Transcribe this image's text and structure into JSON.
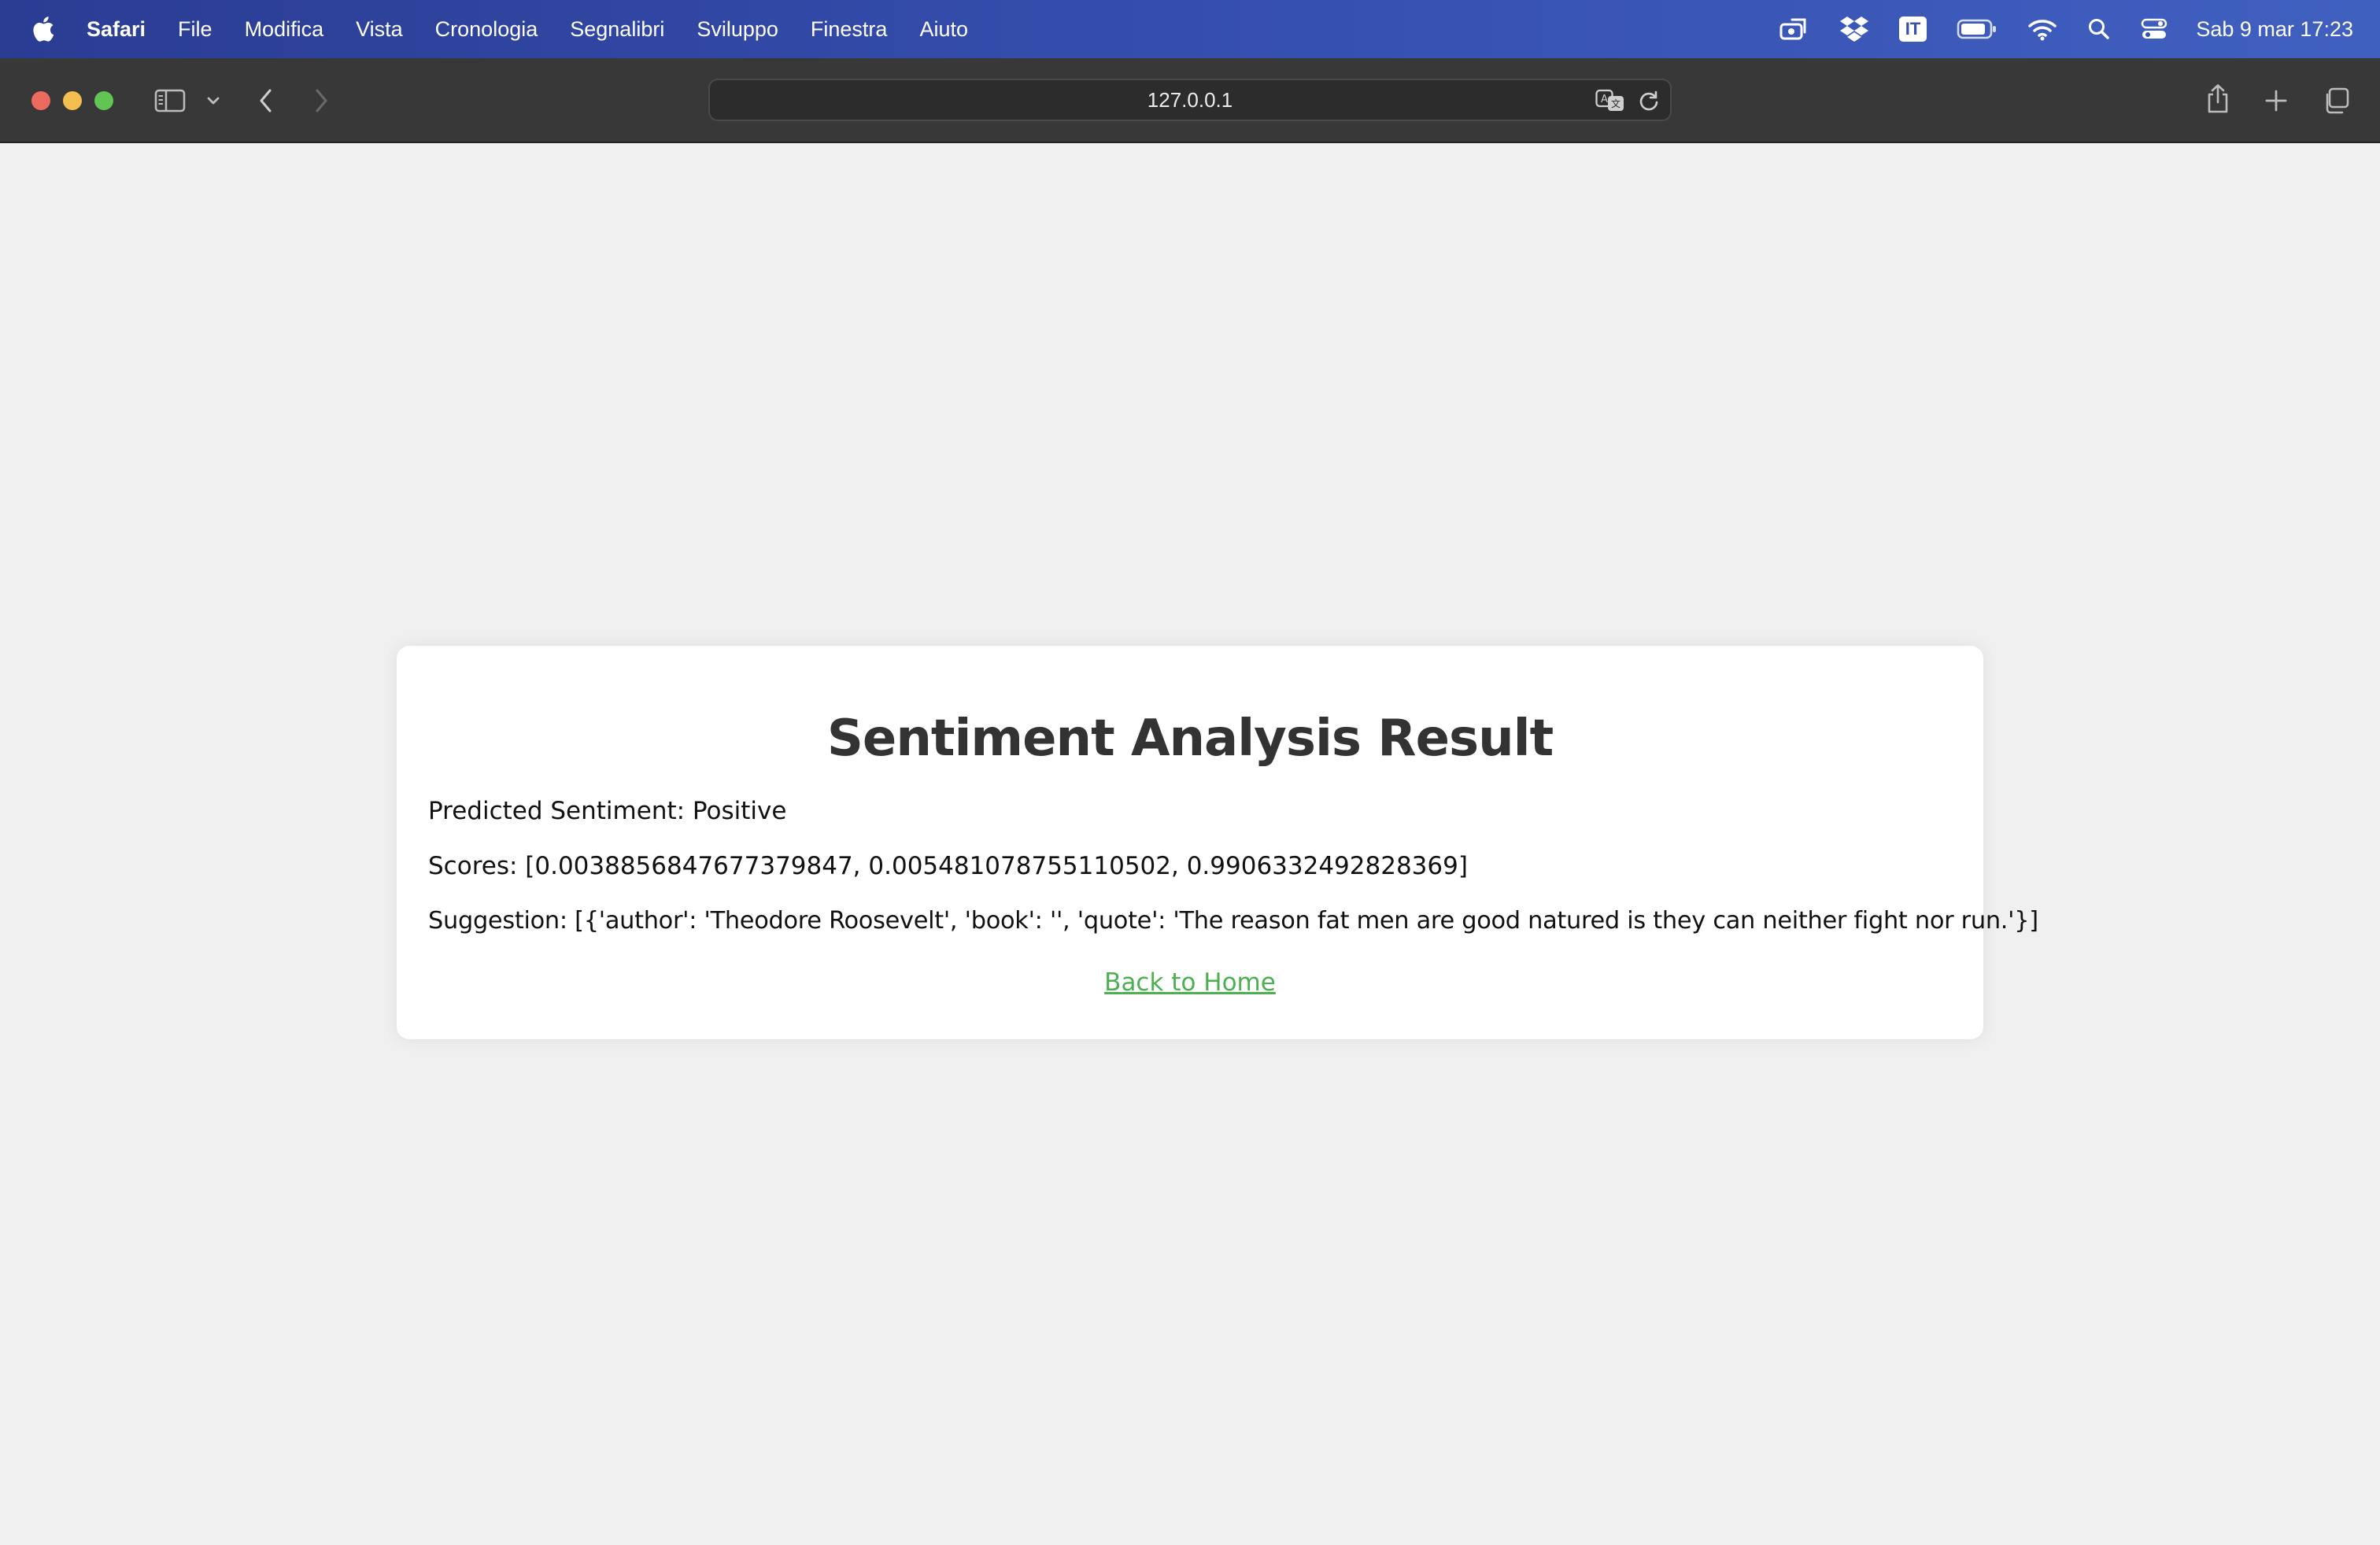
{
  "menubar": {
    "apple_icon": "apple-logo-icon",
    "app_name": "Safari",
    "items": [
      "File",
      "Modifica",
      "Vista",
      "Cronologia",
      "Segnalibri",
      "Sviluppo",
      "Finestra",
      "Aiuto"
    ],
    "status_icons": [
      "stage-manager-icon",
      "dropbox-icon",
      "input-source-icon",
      "battery-icon",
      "wifi-icon",
      "spotlight-search-icon",
      "control-center-icon"
    ],
    "input_source": "IT",
    "clock": "Sab 9 mar  17:23"
  },
  "toolbar": {
    "url": "127.0.0.1",
    "icons": [
      "sidebar-icon",
      "chevron-down-icon",
      "back-icon",
      "forward-icon",
      "translate-icon",
      "reload-icon",
      "share-icon",
      "new-tab-icon",
      "tab-overview-icon"
    ]
  },
  "page": {
    "title": "Sentiment Analysis Result",
    "predicted": "Predicted Sentiment: Positive",
    "scores": "Scores: [0.0038856847677379847, 0.005481078755110502, 0.9906332492828369]",
    "suggestion": "Suggestion: [{'author': 'Theodore Roosevelt', 'book': '', 'quote': 'The reason fat men are good natured is they can neither fight nor run.'}]",
    "back_link": "Back to Home",
    "link_color": "#4caf50",
    "background": "#f0f0f0"
  }
}
